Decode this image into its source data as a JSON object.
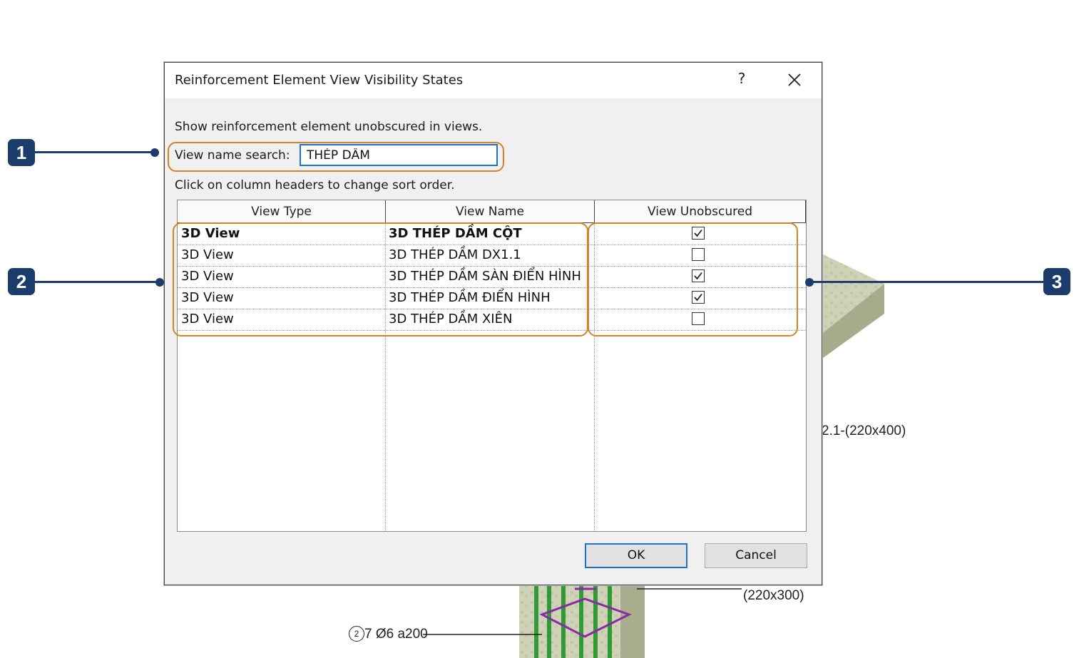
{
  "background": {
    "beam_label": "2.1-(220x400)",
    "column_label": "(220x300)",
    "rebar_mark": "2",
    "rebar_label": "7 Ø6 a200"
  },
  "dialog": {
    "title": "Reinforcement Element View Visibility States",
    "help_label": "?",
    "description": "Show reinforcement element unobscured in views.",
    "search_label": "View name search:",
    "search_value": "THÉP DẦM",
    "sort_hint": "Click on column headers to change sort order.",
    "columns": [
      "View Type",
      "View Name",
      "View Unobscured"
    ],
    "rows": [
      {
        "type": "3D View",
        "name": "3D THÉP DẦM CỘT",
        "unobscured": true,
        "bold": true
      },
      {
        "type": "3D View",
        "name": "3D THÉP DẦM DX1.1",
        "unobscured": false,
        "bold": false
      },
      {
        "type": "3D View",
        "name": "3D THÉP DẦM SÀN ĐIỂN HÌNH",
        "unobscured": true,
        "bold": false
      },
      {
        "type": "3D View",
        "name": "3D THÉP DẦM ĐIỂN HÌNH",
        "unobscured": true,
        "bold": false
      },
      {
        "type": "3D View",
        "name": "3D THÉP DẦM XIÊN",
        "unobscured": false,
        "bold": false
      }
    ],
    "ok_label": "OK",
    "cancel_label": "Cancel"
  },
  "callouts": {
    "one": "1",
    "two": "2",
    "three": "3",
    "color_box": "#d4822a",
    "color_badge": "#1c3d6b"
  }
}
